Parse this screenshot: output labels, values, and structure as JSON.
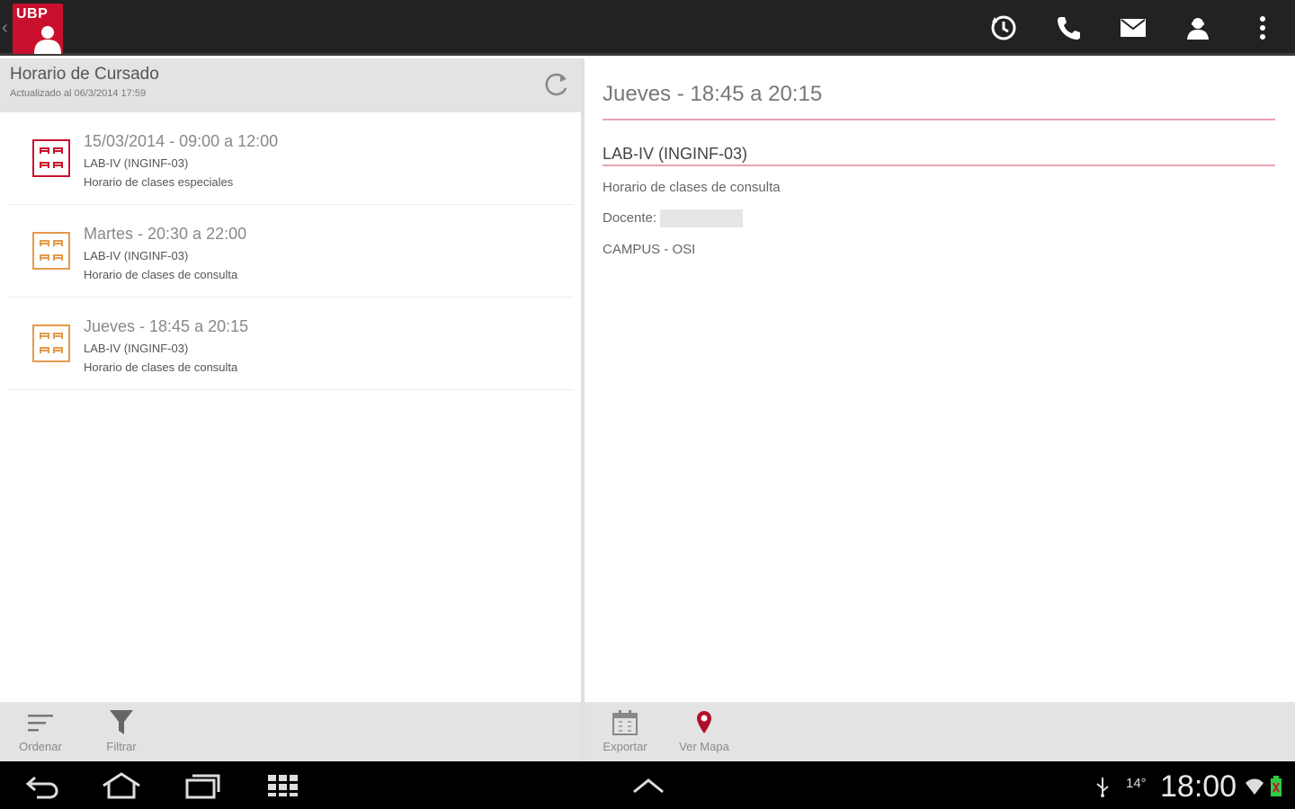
{
  "app": {
    "logo_text": "UBP"
  },
  "actionbar": {
    "icons": [
      "history-icon",
      "phone-icon",
      "mail-icon",
      "profile-icon",
      "overflow-menu-icon"
    ]
  },
  "left": {
    "title": "Horario de Cursado",
    "subtitle": "Actualizado al 06/3/2014 17:59",
    "items": [
      {
        "title": "15/03/2014 - 09:00 a 12:00",
        "line1": "LAB-IV (INGINF-03)",
        "line2": "Horario de clases especiales",
        "color": "#c8102e"
      },
      {
        "title": "Martes - 20:30 a 22:00",
        "line1": "LAB-IV (INGINF-03)",
        "line2": "Horario de clases de consulta",
        "color": "#e59a4a"
      },
      {
        "title": "Jueves - 18:45 a 20:15",
        "line1": "LAB-IV (INGINF-03)",
        "line2": "Horario de clases de consulta",
        "color": "#e59a4a"
      }
    ],
    "toolbar": {
      "sort_label": "Ordenar",
      "filter_label": "Filtrar"
    }
  },
  "right": {
    "title": "Jueves - 18:45 a 20:15",
    "subject": "LAB-IV (INGINF-03)",
    "type": "Horario de clases de consulta",
    "teacher_label": "Docente:",
    "location": "CAMPUS - OSI",
    "toolbar": {
      "export_label": "Exportar",
      "map_label": "Ver Mapa"
    }
  },
  "system": {
    "time": "18:00",
    "temp": "14°"
  },
  "colors": {
    "brand": "#c8102e",
    "accent_orange": "#e59a4a",
    "rule": "#e7a3b0"
  }
}
